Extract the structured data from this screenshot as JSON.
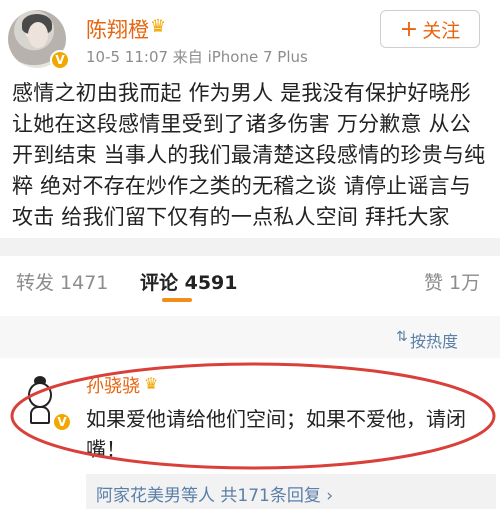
{
  "post": {
    "username": "陈翔橙",
    "meta": "10-5 11:07  来自 iPhone 7 Plus",
    "follow_label": "关注",
    "text": "感情之初由我而起 作为男人 是我没有保护好晓彤\n让她在这段感情里受到了诸多伤害 万分歉意 从公\n开到结束 当事人的我们最清楚这段感情的珍贵与纯\n粹 绝对不存在炒作之类的无稽之谈 请停止谣言与\n攻击 给我们留下仅有的一点私人空间 拜托大家"
  },
  "tabs": {
    "repost": "转发 1471",
    "comment": "评论 4591",
    "like": "赞 1万"
  },
  "sort": {
    "label": "按热度"
  },
  "comment": {
    "username": "孙骁骁",
    "text": "如果爱他请给他们空间；如果不爱他，请闭嘴！",
    "replies_who": "阿家花美男等人",
    "replies_count": "共171条回复",
    "replies_arrow": "›"
  },
  "icons": {
    "verified": "verified-v-icon",
    "crown": "crown-icon",
    "sort": "sort-icon",
    "plus": "plus-icon"
  },
  "colors": {
    "username": "#e8650f",
    "verified": "#f2a600",
    "link": "#5a7fa8",
    "highlight": "#d9403a",
    "tab_underline": "#f28c1a"
  }
}
